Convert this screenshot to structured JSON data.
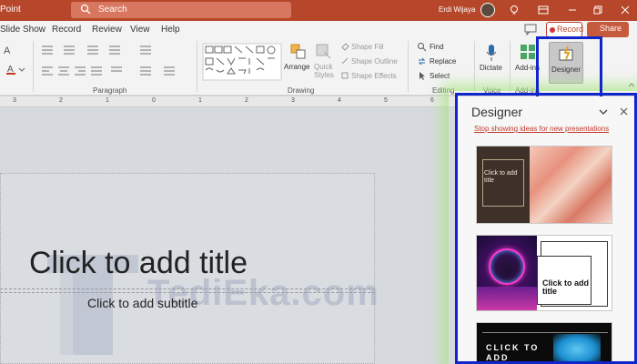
{
  "titlebar": {
    "app_name": "Point",
    "search_placeholder": "Search",
    "user_name": "Erdi Wijaya"
  },
  "tabs": [
    "Slide Show",
    "Record",
    "Review",
    "View",
    "Help"
  ],
  "actions": {
    "record_label": "Record",
    "share_label": "Share"
  },
  "ribbon": {
    "groups": {
      "paragraph": "Paragraph",
      "drawing": "Drawing",
      "editing": "Editing",
      "voice": "Voice",
      "addins": "Add-ins"
    },
    "arrange": "Arrange",
    "quick_styles": "Quick Styles",
    "shape_fill": "Shape Fill",
    "shape_outline": "Shape Outline",
    "shape_effects": "Shape Effects",
    "find": "Find",
    "replace": "Replace",
    "select": "Select",
    "dictate": "Dictate",
    "addins_btn": "Add-ins",
    "designer_btn": "Designer"
  },
  "ruler": {
    "numbers": [
      "3",
      "2",
      "1",
      "0",
      "1",
      "2",
      "3",
      "4",
      "5",
      "6"
    ]
  },
  "slide": {
    "title": "Click to add title",
    "subtitle": "Click to add subtitle",
    "watermark": "TediEka.com"
  },
  "designer": {
    "title": "Designer",
    "stop_link": "Stop showing ideas for new presentations",
    "cards": [
      {
        "text": "Click to add title"
      },
      {
        "text": "Click to add title"
      },
      {
        "text": "CLICK TO ADD"
      }
    ]
  },
  "colors": {
    "accent": "#b7472a",
    "highlight": "#1126c8",
    "link": "#c0392b"
  }
}
